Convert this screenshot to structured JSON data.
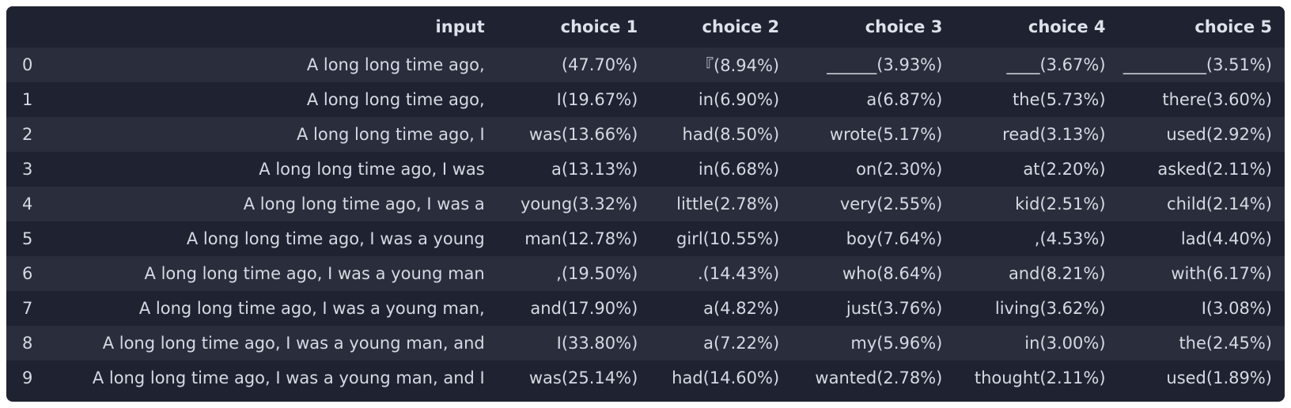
{
  "columns": [
    "",
    "input",
    "choice 1",
    "choice 2",
    "choice 3",
    "choice 4",
    "choice 5"
  ],
  "rows": [
    [
      "0",
      "A long long time ago,",
      "(47.70%)",
      "『(8.94%)",
      "______(3.93%)",
      "____(3.67%)",
      "__________(3.51%)"
    ],
    [
      "1",
      "A long long time ago,",
      "I(19.67%)",
      "in(6.90%)",
      "a(6.87%)",
      "the(5.73%)",
      "there(3.60%)"
    ],
    [
      "2",
      "A long long time ago,  I",
      "was(13.66%)",
      "had(8.50%)",
      "wrote(5.17%)",
      "read(3.13%)",
      "used(2.92%)"
    ],
    [
      "3",
      "A long long time ago,  I was",
      "a(13.13%)",
      "in(6.68%)",
      "on(2.30%)",
      "at(2.20%)",
      "asked(2.11%)"
    ],
    [
      "4",
      "A long long time ago,  I was a",
      "young(3.32%)",
      "little(2.78%)",
      "very(2.55%)",
      "kid(2.51%)",
      "child(2.14%)"
    ],
    [
      "5",
      "A long long time ago,  I was a young",
      "man(12.78%)",
      "girl(10.55%)",
      "boy(7.64%)",
      ",(4.53%)",
      "lad(4.40%)"
    ],
    [
      "6",
      "A long long time ago,  I was a young man",
      ",(19.50%)",
      ".(14.43%)",
      "who(8.64%)",
      "and(8.21%)",
      "with(6.17%)"
    ],
    [
      "7",
      "A long long time ago,  I was a young man,",
      "and(17.90%)",
      "a(4.82%)",
      "just(3.76%)",
      "living(3.62%)",
      "I(3.08%)"
    ],
    [
      "8",
      "A long long time ago,  I was a young man, and",
      "I(33.80%)",
      "a(7.22%)",
      "my(5.96%)",
      "in(3.00%)",
      "the(2.45%)"
    ],
    [
      "9",
      "A long long time ago,  I was a young man, and I",
      "was(25.14%)",
      "had(14.60%)",
      "wanted(2.78%)",
      "thought(2.11%)",
      "used(1.89%)"
    ]
  ],
  "colors": {
    "background": "#1f2331",
    "stripe": "#2a2e3c",
    "text": "#d6d9e2",
    "page": "#ffffff"
  }
}
